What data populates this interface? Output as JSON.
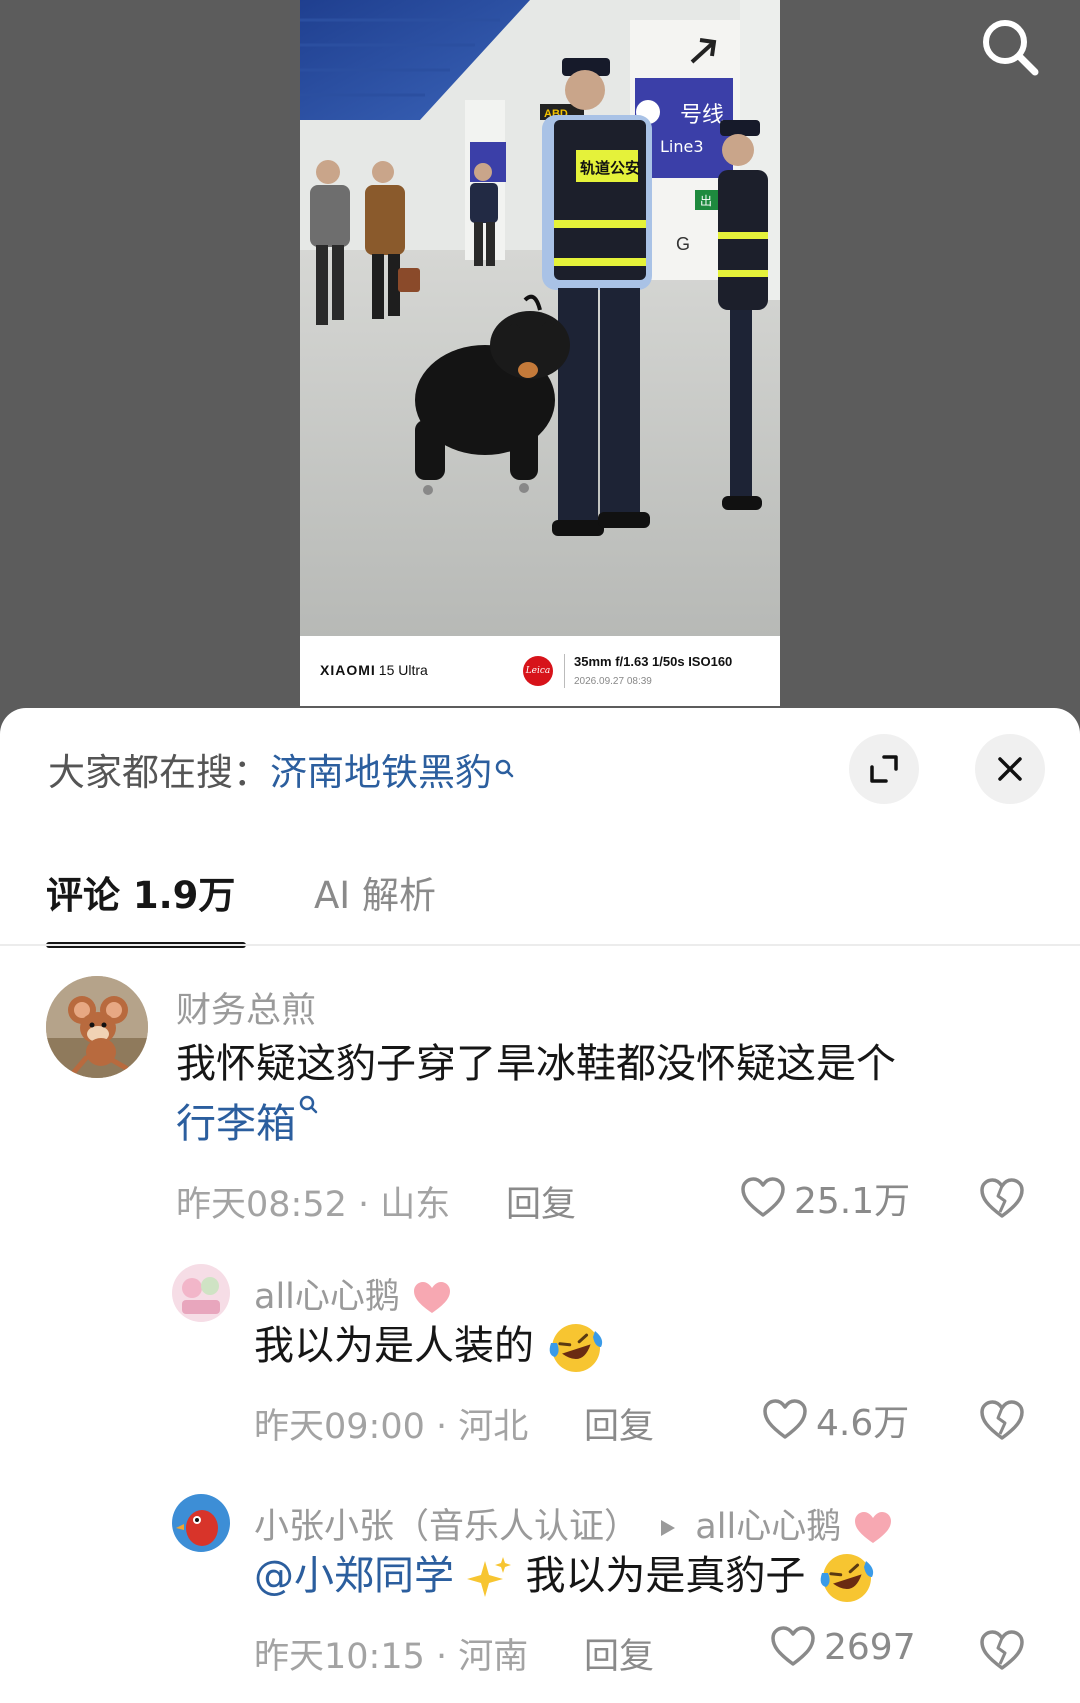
{
  "photo": {
    "brand": "XIAOMI",
    "model": "15 Ultra",
    "leica": "Leica",
    "exif": "35mm  f/1.63  1/50s  ISO160",
    "date": "2026.09.27 08:39",
    "vest_label": "轨道公安",
    "sign_line": "号线",
    "sign_line_en": "Line3",
    "sign_abd": "ABD",
    "sign_exit": "出",
    "sign_g": "G"
  },
  "hot_search": {
    "prefix": "大家都在搜：",
    "term": "济南地铁黑豹"
  },
  "tabs": [
    {
      "label": "评论 1.9万",
      "active": true
    },
    {
      "label": "AI 解析",
      "active": false
    }
  ],
  "comments": [
    {
      "username": "财务总煎",
      "text_plain": "我怀疑这豹子穿了旱冰鞋都没怀疑这是个",
      "text_link": "行李箱",
      "time": "昨天08:52",
      "dot": " · ",
      "location": "山东",
      "reply_label": "回复",
      "likes": "25.1万",
      "avatar": "cartoon-mouse"
    },
    {
      "username": "all心心鹅",
      "text_plain": "我以为是人装的",
      "time": "昨天09:00",
      "dot": " · ",
      "location": "河北",
      "reply_label": "回复",
      "likes": "4.6万",
      "avatar": "pink-illustration"
    },
    {
      "username": "小张小张（音乐人认证）",
      "reply_to": "all心心鹅",
      "mention": "@小郑同学",
      "text_plain": " 我以为是真豹子",
      "time": "昨天10:15",
      "dot": " · ",
      "location": "河南",
      "reply_label": "回复",
      "likes": "2697",
      "avatar": "red-bird"
    }
  ],
  "colors": {
    "link": "#2b5e9e",
    "text": "#161616",
    "muted": "#9a9a9a",
    "sheet": "#ffffff",
    "backdrop": "#5c5c5c"
  }
}
